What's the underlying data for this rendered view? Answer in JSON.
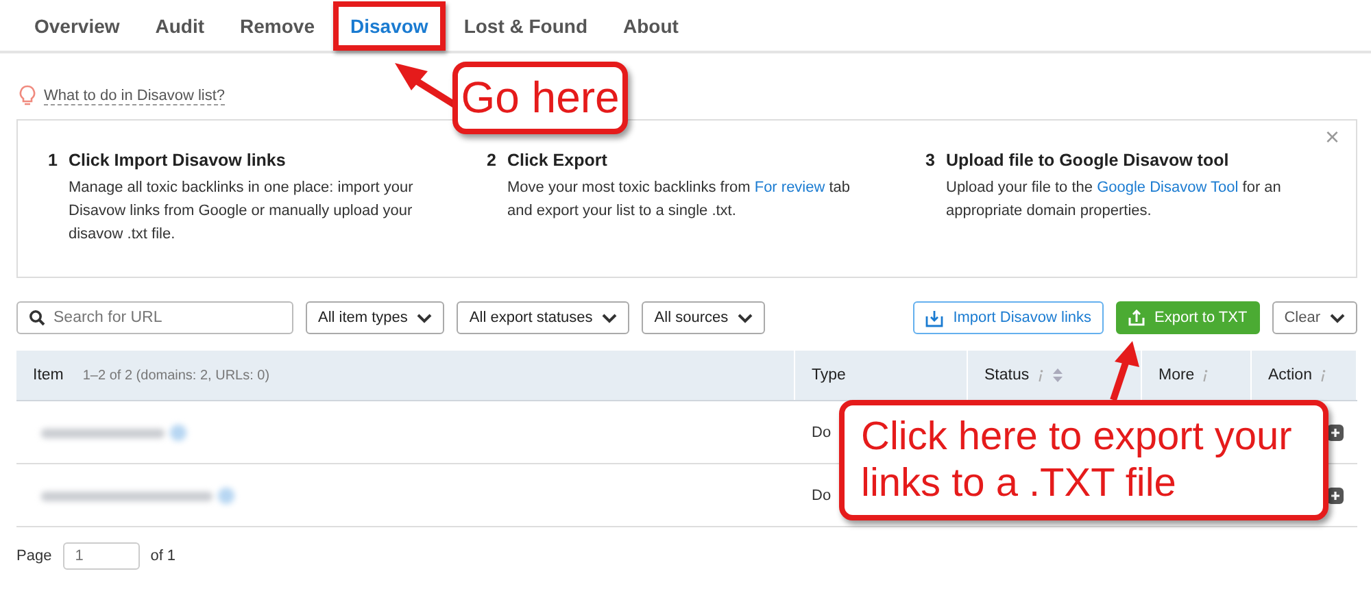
{
  "tabs": [
    {
      "label": "Overview",
      "selected": false,
      "highlighted": false
    },
    {
      "label": "Audit",
      "selected": false,
      "highlighted": false
    },
    {
      "label": "Remove",
      "selected": false,
      "highlighted": false
    },
    {
      "label": "Disavow",
      "selected": true,
      "highlighted": true
    },
    {
      "label": "Lost & Found",
      "selected": false,
      "highlighted": false
    },
    {
      "label": "About",
      "selected": false,
      "highlighted": false
    }
  ],
  "hint_link": "What to do in Disavow list?",
  "steps": [
    {
      "number": "1",
      "title": "Click Import Disavow links",
      "text": "Manage all toxic backlinks in one place: import your Disavow links from Google or manually upload your disavow .txt file."
    },
    {
      "number": "2",
      "title": "Click Export",
      "text": "Move your most toxic backlinks from ",
      "link": "For review",
      "text_after": " tab and export your list to a single .txt."
    },
    {
      "number": "3",
      "title": "Upload file to Google Disavow tool",
      "text": "Upload your file to the ",
      "link": "Google Disavow Tool",
      "text_after": " for an appropriate domain properties."
    }
  ],
  "close": "×",
  "search": {
    "placeholder": "Search for URL"
  },
  "filters": [
    "All item types",
    "All export statuses",
    "All sources"
  ],
  "buttons": [
    {
      "label": "Import Disavow links",
      "kind": "outline"
    },
    {
      "label": "Export to TXT",
      "kind": "primary"
    },
    {
      "label": "Clear",
      "kind": "dropdown"
    }
  ],
  "table": {
    "columns": [
      {
        "label": "Item",
        "note": "1–2 of 2 (domains: 2, URLs: 0)",
        "info": false,
        "sort": false
      },
      {
        "label": "Type",
        "info": false,
        "sort": false
      },
      {
        "label": "Status",
        "info": true,
        "sort": true
      },
      {
        "label": "More",
        "info": true,
        "sort": false
      },
      {
        "label": "Action",
        "info": true,
        "sort": false
      }
    ],
    "rows": [
      {
        "type": "Do"
      },
      {
        "type": "Do"
      }
    ]
  },
  "pagination": {
    "label": "Page",
    "placeholder": "1",
    "total": "of 1"
  },
  "annotations": [
    {
      "text": "Go here",
      "kind": "tab"
    },
    {
      "text": "Click here to export your links to a .TXT file",
      "kind": "export"
    }
  ]
}
